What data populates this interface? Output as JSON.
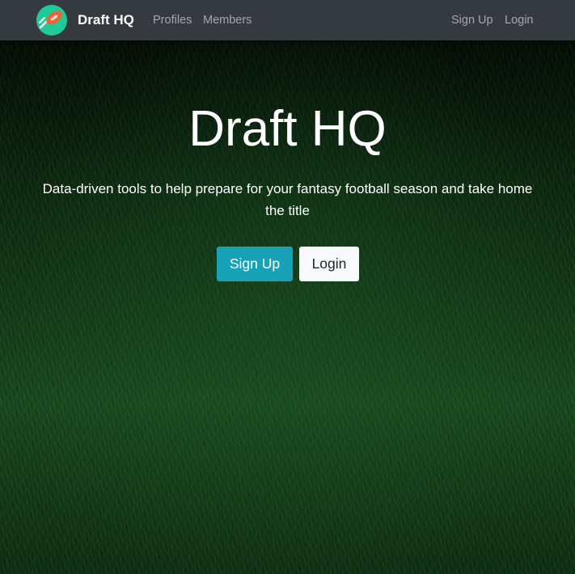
{
  "navbar": {
    "brand_name": "Draft HQ",
    "logo_icon": "football-icon",
    "links_left": [
      "Profiles",
      "Members"
    ],
    "links_right": [
      "Sign Up",
      "Login"
    ],
    "background_color": "#343a40"
  },
  "hero": {
    "title": "Draft HQ",
    "lead": "Data-driven tools to help prepare for your fantasy football season and take home the title",
    "signup_button": "Sign Up",
    "login_button": "Login",
    "background": "grass-field"
  },
  "colors": {
    "accent": "#17a2b8",
    "light_button": "#f8f9fa",
    "logo_circle": "#20c997",
    "football": "#e8643a"
  }
}
